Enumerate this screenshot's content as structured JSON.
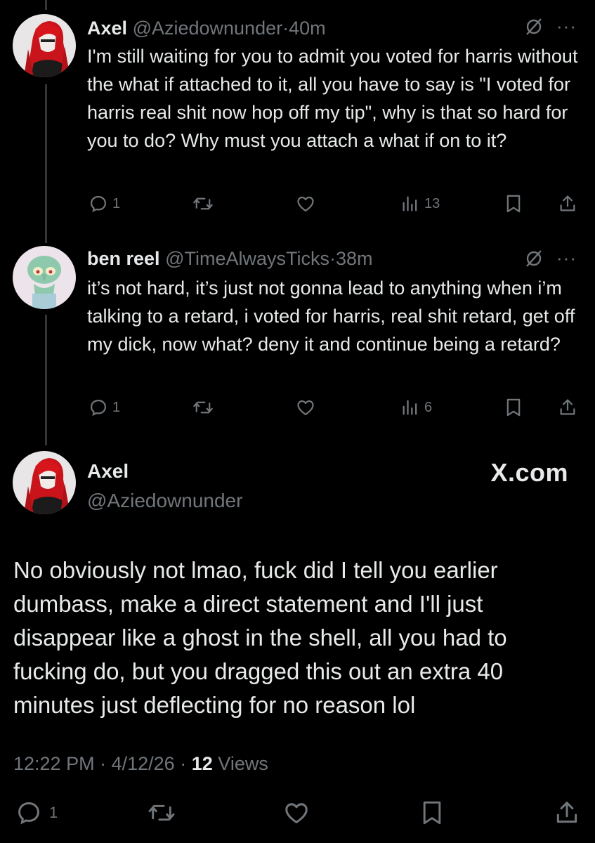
{
  "tweets": [
    {
      "name": "Axel",
      "handle": "@Aziedownunder",
      "time": "40m",
      "text": "I'm still waiting for you to admit you voted for harris without the what if attached to it, all you have to say is \"I voted for harris real shit now hop off my tip\", why is that so hard for you to do? Why must you attach a what if on to it?",
      "replies": "1",
      "views": "13"
    },
    {
      "name": "ben reel",
      "handle": "@TimeAlwaysTicks",
      "time": "38m",
      "text": "it’s not hard, it’s just not gonna lead to anything when i’m talking to a retard, i voted for harris, real shit retard, get off my dick, now what? deny it and continue being a retard?",
      "replies": "1",
      "views": "6"
    }
  ],
  "main": {
    "name": "Axel",
    "handle": "@Aziedownunder",
    "watermark": "X.com",
    "text": "No obviously not lmao, fuck did I tell you earlier dumbass, make a direct statement and I'll just disappear like a ghost in the shell, all you had to fucking do, but you dragged this out an extra 40 minutes just deflecting for no reason lol",
    "time": "12:22 PM",
    "date": "4/12/26",
    "views_count": "12",
    "views_label": "Views",
    "replies": "1"
  },
  "separator": "·",
  "more_glyph": "···",
  "colors": {
    "background": "#000000",
    "text": "#e7e9ea",
    "muted": "#71767b",
    "line": "#333639"
  },
  "icons": [
    "reply-icon",
    "retweet-icon",
    "like-icon",
    "views-icon",
    "bookmark-icon",
    "share-icon",
    "grok-icon",
    "more-icon"
  ]
}
